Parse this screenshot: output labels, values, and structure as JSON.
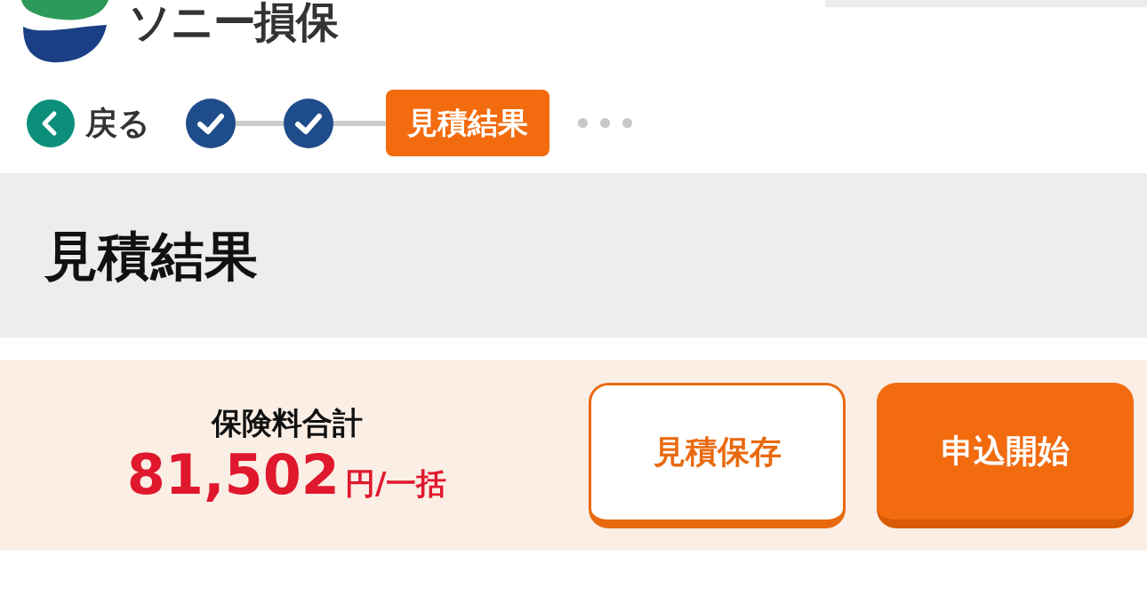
{
  "logo": {
    "text": "ソニー損保"
  },
  "back": {
    "label": "戻る"
  },
  "steps": [
    {
      "kind": "done"
    },
    {
      "kind": "done"
    },
    {
      "kind": "current",
      "label": "見積結果"
    },
    {
      "kind": "pending"
    },
    {
      "kind": "pending"
    },
    {
      "kind": "pending"
    }
  ],
  "page_title": "見積結果",
  "premium": {
    "label": "保険料合計",
    "amount": "81,502",
    "unit": "円/一括"
  },
  "buttons": [
    {
      "kind": "secondary",
      "label": "見積保存"
    },
    {
      "kind": "primary",
      "label": "申込開始"
    }
  ]
}
